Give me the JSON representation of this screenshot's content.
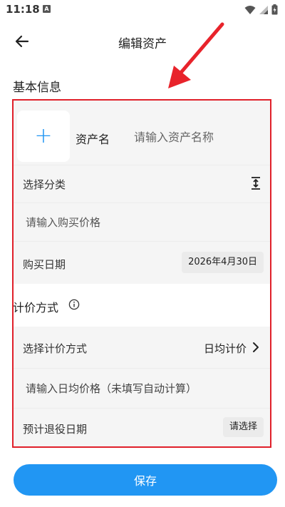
{
  "status_bar": {
    "time": "11:18",
    "notification_badge": "A",
    "icons": [
      "wifi-icon",
      "signal-icon",
      "battery-charging-icon"
    ]
  },
  "header": {
    "title": "编辑资产",
    "back_icon": "arrow-left-icon"
  },
  "basic_info": {
    "section_title": "基本信息",
    "asset_icon_button": "+",
    "asset_name_label": "资产名",
    "asset_name_placeholder": "请输入资产名称",
    "asset_name_value": "",
    "category_label": "选择分类",
    "purchase_price_placeholder": "请输入购买价格",
    "purchase_price_value": "",
    "purchase_date_label": "购买日期",
    "purchase_date_value": "2026年4月30日"
  },
  "pricing": {
    "section_title": "计价方式",
    "method_label": "选择计价方式",
    "method_value": "日均计价",
    "daily_price_placeholder": "请输入日均价格（未填写自动计算）",
    "daily_price_value": "",
    "retire_date_label": "预计退役日期",
    "retire_date_value": "请选择"
  },
  "actions": {
    "save_label": "保存"
  },
  "colors": {
    "accent": "#2196f3",
    "highlight": "#e0202a",
    "row_background": "#f5f5f5"
  }
}
